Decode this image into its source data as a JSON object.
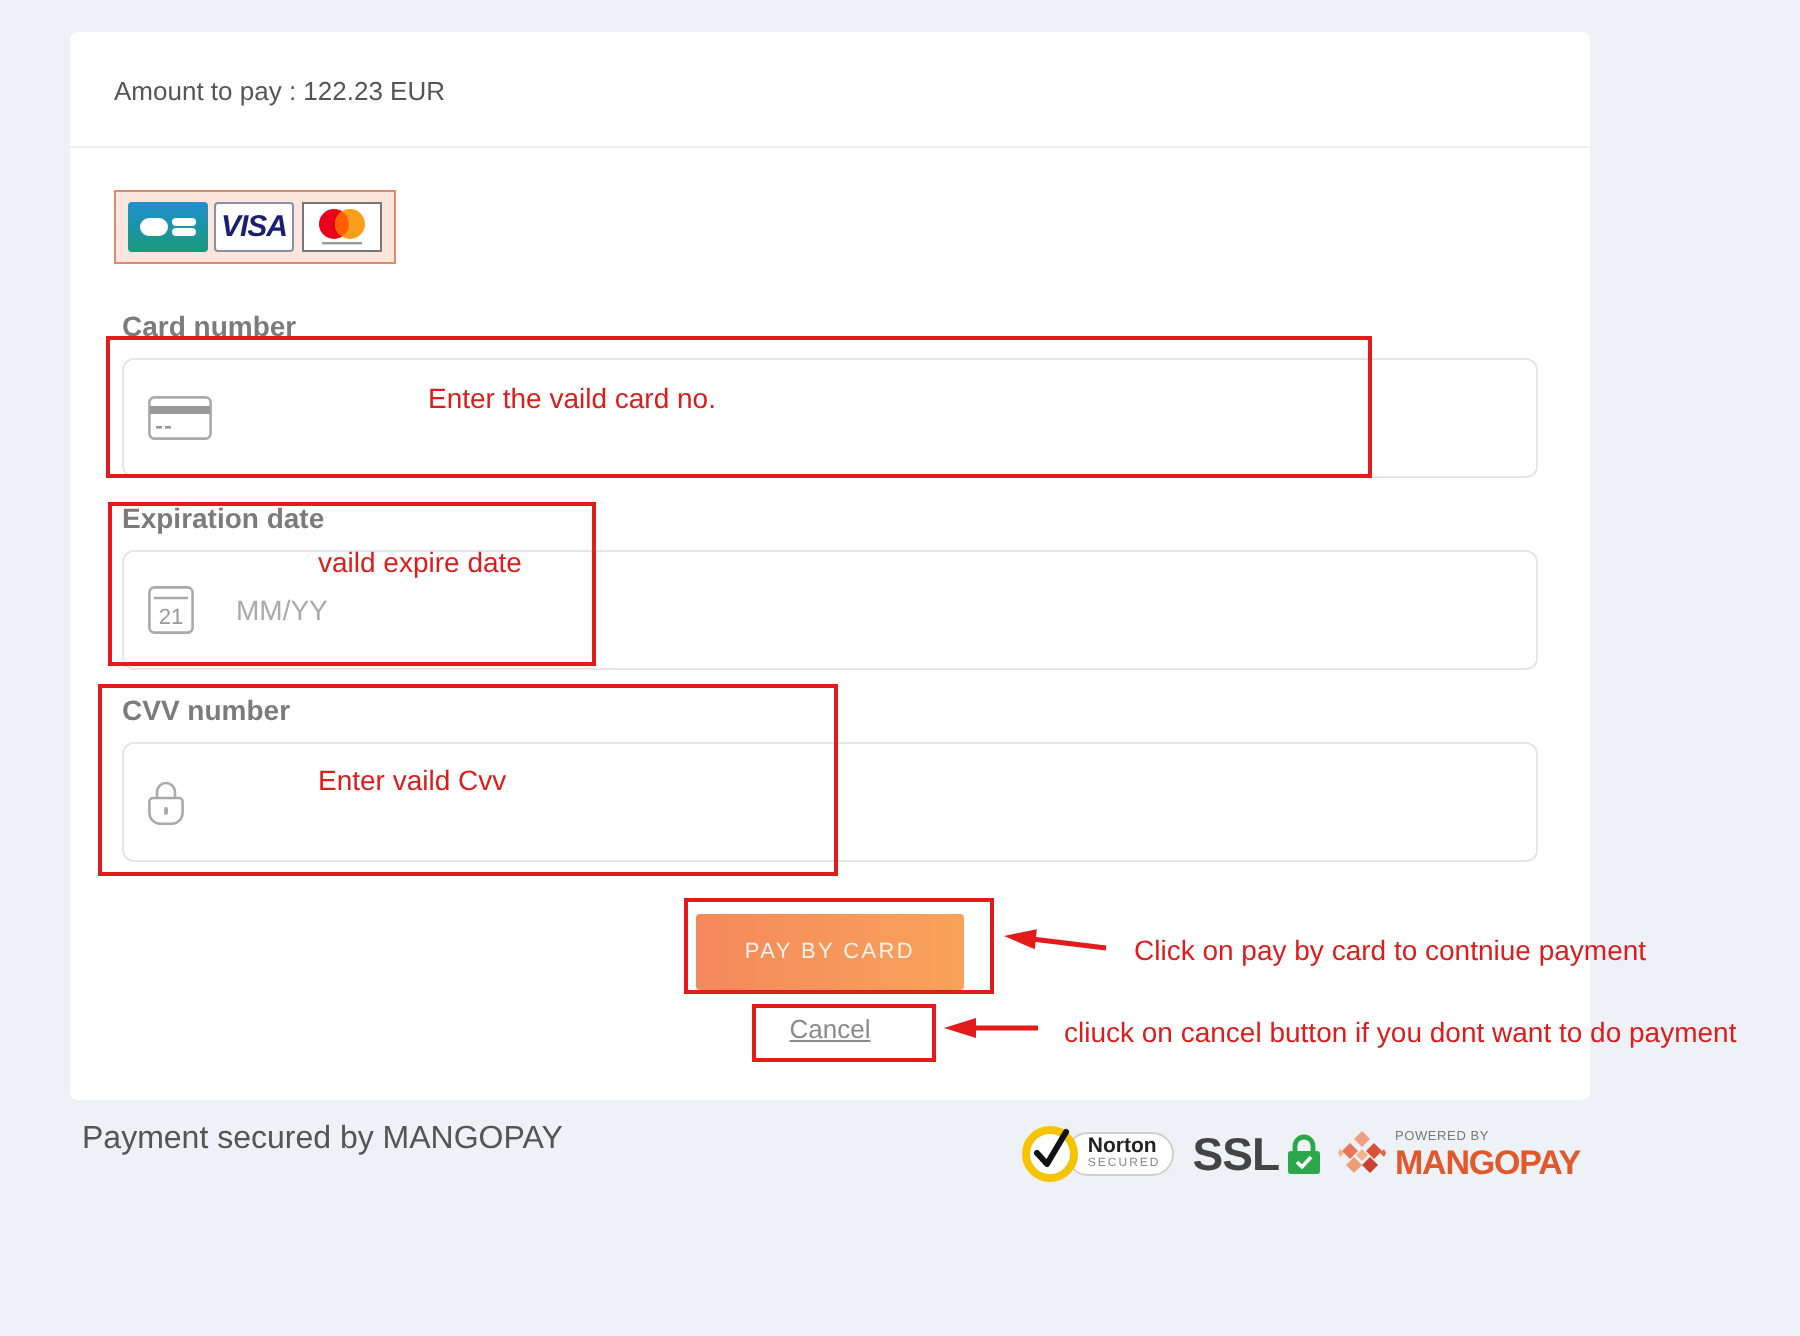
{
  "amount": {
    "label": "Amount to pay : 122.23 EUR"
  },
  "card_brands": [
    {
      "kind": "cb"
    },
    {
      "kind": "visa",
      "text": "VISA"
    },
    {
      "kind": "mastercard"
    }
  ],
  "fields": [
    {
      "kind": "card",
      "label": "Card number"
    },
    {
      "kind": "date",
      "label": "Expiration date",
      "placeholder": "MM/YY",
      "icon_text": "21"
    },
    {
      "kind": "cvv",
      "label": "CVV number"
    }
  ],
  "pay_button": {
    "label": "PAY BY CARD"
  },
  "cancel_link": {
    "label": "Cancel"
  },
  "footer": {
    "text": "Payment secured by MANGOPAY",
    "badges": [
      {
        "kind": "norton",
        "title": "Norton",
        "caption": "SECURED"
      },
      {
        "kind": "ssl",
        "text": "SSL"
      },
      {
        "kind": "mangopay",
        "caption": "POWERED BY",
        "name": "MANGOPAY"
      }
    ]
  },
  "annotations": [
    {
      "note": "Enter the vaild card no.",
      "arrow": false
    },
    {
      "note": "vaild expire date",
      "arrow": false
    },
    {
      "note": "Enter vaild Cvv",
      "arrow": false
    },
    {
      "note": "Click on pay by card to contniue payment",
      "arrow": true
    },
    {
      "note": "cliuck on cancel button if you dont want to do payment",
      "arrow": true
    }
  ]
}
